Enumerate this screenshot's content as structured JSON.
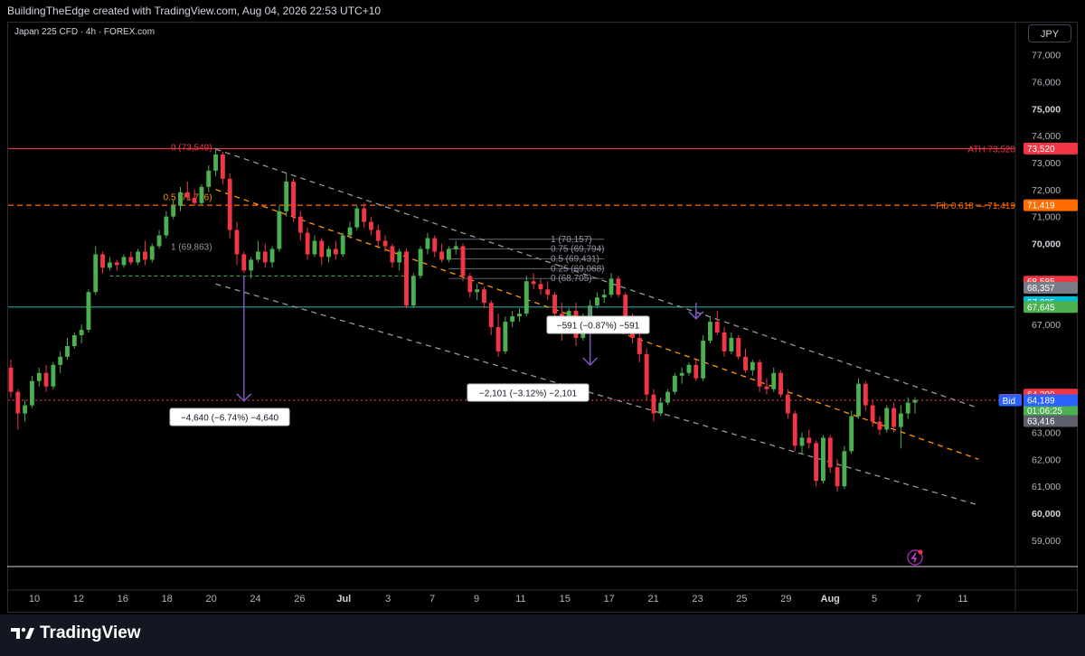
{
  "header": {
    "attribution": "BuildingTheEdge created with TradingView.com, Aug 04, 2026 22:53 UTC+10"
  },
  "toolbar": {
    "currency_label": "JPY"
  },
  "footer": {
    "brand": "TradingView"
  },
  "colors": {
    "up": "#4caf50",
    "down": "#f23645",
    "resistance": "#f23645",
    "fib": "#ff6d00",
    "support_green": "#4caf50",
    "teal": "#2a9d9d",
    "channel": "#9598a1",
    "channel_mid": "#ff9800",
    "measure": "#7e57c2"
  },
  "chart_data": {
    "type": "candlestick",
    "title": "Japan 225 CFD · 4h · FOREX.com",
    "y_axis": {
      "range": [
        58000,
        77500
      ],
      "ticks": [
        {
          "value": 77000,
          "label": "77,000"
        },
        {
          "value": 76000,
          "label": "76,000"
        },
        {
          "value": 75000,
          "label": "75,000",
          "major": true
        },
        {
          "value": 74000,
          "label": "74,000"
        },
        {
          "value": 73000,
          "label": "73,000"
        },
        {
          "value": 72000,
          "label": "72,000"
        },
        {
          "value": 71000,
          "label": "71,000"
        },
        {
          "value": 70000,
          "label": "70,000",
          "major": true
        },
        {
          "value": 67000,
          "label": "67,000"
        },
        {
          "value": 63000,
          "label": "63,000"
        },
        {
          "value": 62000,
          "label": "62,000"
        },
        {
          "value": 61000,
          "label": "61,000"
        },
        {
          "value": 60000,
          "label": "60,000",
          "major": true
        },
        {
          "value": 59000,
          "label": "59,000"
        }
      ]
    },
    "x_axis": {
      "ticks": [
        {
          "label": "10"
        },
        {
          "label": "12"
        },
        {
          "label": "16"
        },
        {
          "label": "18"
        },
        {
          "label": "20"
        },
        {
          "label": "24"
        },
        {
          "label": "26"
        },
        {
          "label": "Jul",
          "major": true
        },
        {
          "label": "3"
        },
        {
          "label": "7"
        },
        {
          "label": "9"
        },
        {
          "label": "11"
        },
        {
          "label": "15"
        },
        {
          "label": "17"
        },
        {
          "label": "21"
        },
        {
          "label": "23"
        },
        {
          "label": "25"
        },
        {
          "label": "29"
        },
        {
          "label": "Aug",
          "major": true
        },
        {
          "label": "5"
        },
        {
          "label": "7"
        },
        {
          "label": "11"
        }
      ]
    },
    "price_tags": [
      {
        "text": "73,520",
        "value": 73520,
        "color": "#f23645",
        "prefix": "ATH 73,520"
      },
      {
        "text": "71,419",
        "value": 71419,
        "color": "#ff6d00",
        "prefix": "Fib 0.618 — 71,419"
      },
      {
        "text": "68,585",
        "value": 68585,
        "color": "#f23645"
      },
      {
        "text": "68,357",
        "value": 68357,
        "color": "#787b86"
      },
      {
        "text": "67,825",
        "value": 67825,
        "color": "#00bcd4"
      },
      {
        "text": "67,645",
        "value": 67645,
        "color": "#4caf50"
      },
      {
        "text": "64,399",
        "value": 64399,
        "color": "#f23645"
      },
      {
        "text": "64,204",
        "value": 64204,
        "color": "#f23645",
        "prefix": "Ask"
      },
      {
        "text": "64,194",
        "value": 64194,
        "color": "#4caf50",
        "sub": "01:06:25"
      },
      {
        "text": "64,189",
        "value": 64189,
        "color": "#2962ff",
        "prefix": "Bid"
      },
      {
        "text": "63,416",
        "value": 63416,
        "color": "#5d606b"
      }
    ],
    "horizontal_lines": [
      {
        "value": 73520,
        "style": "solid",
        "color": "#f23645"
      },
      {
        "value": 71419,
        "style": "dashed",
        "color": "#ff6d00"
      },
      {
        "value": 67645,
        "style": "solid",
        "color": "#26a69a"
      },
      {
        "value": 64189,
        "style": "dotted",
        "color": "#f23645"
      }
    ],
    "fib_labels_left": [
      {
        "text": "0 (73,549)",
        "value": 73549
      },
      {
        "text": "0.5 (71,706)",
        "value": 71706
      },
      {
        "text": "1 (69,863)",
        "value": 69863
      }
    ],
    "fib_labels_mid": [
      {
        "text": "1 (70,157)",
        "value": 70157
      },
      {
        "text": "0.75 (69,794)",
        "value": 69794
      },
      {
        "text": "0.5 (69,431)",
        "value": 69431
      },
      {
        "text": "0.25 (69,068)",
        "value": 69068
      },
      {
        "text": "0 (68,705)",
        "value": 68705
      }
    ],
    "measurements": [
      {
        "text": "−4,640 (−6.74%) −4,640",
        "from": 68800,
        "to": 64160
      },
      {
        "text": "−2,101 (−3.12%) −2,101",
        "from": 67600,
        "to": 65499
      },
      {
        "text": "−591 (−0.87%) −591",
        "from": 67800,
        "to": 67209
      }
    ],
    "candles": [
      [
        65400,
        65700,
        64300,
        64500
      ],
      [
        64500,
        64600,
        63100,
        63700
      ],
      [
        63700,
        64200,
        63400,
        64000
      ],
      [
        64000,
        65100,
        63900,
        64900
      ],
      [
        64900,
        65400,
        64700,
        65200
      ],
      [
        65200,
        65500,
        64500,
        64700
      ],
      [
        64700,
        65600,
        64600,
        65500
      ],
      [
        65500,
        66000,
        65200,
        65800
      ],
      [
        65800,
        66500,
        65700,
        66200
      ],
      [
        66200,
        66700,
        66100,
        66600
      ],
      [
        66600,
        67000,
        66300,
        66800
      ],
      [
        66800,
        68300,
        66700,
        68200
      ],
      [
        68200,
        69900,
        68100,
        69600
      ],
      [
        69600,
        69700,
        68900,
        69100
      ],
      [
        69100,
        69500,
        69000,
        69300
      ],
      [
        69300,
        69400,
        69000,
        69200
      ],
      [
        69200,
        69600,
        69100,
        69500
      ],
      [
        69500,
        69700,
        69200,
        69300
      ],
      [
        69300,
        69800,
        69200,
        69700
      ],
      [
        69700,
        70100,
        69200,
        69400
      ],
      [
        69400,
        70000,
        69300,
        69900
      ],
      [
        69900,
        70500,
        69800,
        70300
      ],
      [
        70300,
        71200,
        70200,
        71000
      ],
      [
        71000,
        71600,
        70900,
        71400
      ],
      [
        71400,
        72100,
        71200,
        71900
      ],
      [
        71900,
        72300,
        71600,
        71700
      ],
      [
        71700,
        72000,
        71400,
        71500
      ],
      [
        71500,
        72200,
        71400,
        72100
      ],
      [
        72100,
        72900,
        71900,
        72700
      ],
      [
        72700,
        73550,
        72500,
        73300
      ],
      [
        73300,
        73400,
        72200,
        72400
      ],
      [
        72400,
        72600,
        70200,
        70500
      ],
      [
        70500,
        70800,
        69200,
        69600
      ],
      [
        69600,
        69700,
        68900,
        69000
      ],
      [
        69000,
        69500,
        68700,
        69400
      ],
      [
        69400,
        70100,
        69300,
        69700
      ],
      [
        69700,
        70000,
        69100,
        69300
      ],
      [
        69300,
        69900,
        69100,
        69800
      ],
      [
        69800,
        71400,
        69700,
        71200
      ],
      [
        71200,
        72600,
        71000,
        72300
      ],
      [
        72300,
        72400,
        70800,
        71000
      ],
      [
        71000,
        71200,
        70100,
        70400
      ],
      [
        70400,
        70600,
        69400,
        69600
      ],
      [
        69600,
        70300,
        69500,
        70100
      ],
      [
        70100,
        70200,
        69200,
        69500
      ],
      [
        69500,
        69900,
        69300,
        69800
      ],
      [
        69800,
        70100,
        69400,
        69600
      ],
      [
        69600,
        70400,
        69500,
        70300
      ],
      [
        70300,
        70800,
        70200,
        70600
      ],
      [
        70600,
        71400,
        70500,
        71300
      ],
      [
        71300,
        71500,
        70600,
        70800
      ],
      [
        70800,
        71000,
        70300,
        70500
      ],
      [
        70500,
        70700,
        69900,
        70100
      ],
      [
        70100,
        70300,
        69700,
        69900
      ],
      [
        69900,
        70000,
        69100,
        69300
      ],
      [
        69300,
        69800,
        69000,
        69700
      ],
      [
        69700,
        69800,
        67600,
        67700
      ],
      [
        67700,
        68900,
        67600,
        68800
      ],
      [
        68800,
        69900,
        68700,
        69800
      ],
      [
        69800,
        70400,
        69600,
        70200
      ],
      [
        70200,
        70300,
        69500,
        69700
      ],
      [
        69700,
        70000,
        69300,
        69400
      ],
      [
        69400,
        69900,
        69300,
        69800
      ],
      [
        69800,
        70100,
        69600,
        69900
      ],
      [
        69900,
        70000,
        68600,
        68800
      ],
      [
        68800,
        68900,
        68000,
        68200
      ],
      [
        68200,
        68500,
        67900,
        68300
      ],
      [
        68300,
        68400,
        67600,
        67800
      ],
      [
        67800,
        67900,
        66600,
        66900
      ],
      [
        66900,
        67400,
        65800,
        66000
      ],
      [
        66000,
        67300,
        65900,
        67100
      ],
      [
        67100,
        67500,
        66900,
        67300
      ],
      [
        67300,
        67600,
        67100,
        67400
      ],
      [
        67400,
        68800,
        67300,
        68600
      ],
      [
        68600,
        68900,
        68300,
        68500
      ],
      [
        68500,
        68700,
        68100,
        68300
      ],
      [
        68300,
        68600,
        67900,
        68100
      ],
      [
        68100,
        68200,
        67200,
        67400
      ],
      [
        67400,
        67800,
        66400,
        66900
      ],
      [
        66900,
        67600,
        66700,
        67500
      ],
      [
        67500,
        67800,
        66200,
        66500
      ],
      [
        66500,
        67400,
        66400,
        67200
      ],
      [
        67200,
        67900,
        67100,
        67700
      ],
      [
        67700,
        68200,
        67600,
        68000
      ],
      [
        68000,
        68300,
        67800,
        68100
      ],
      [
        68100,
        68900,
        68000,
        68700
      ],
      [
        68700,
        68800,
        68000,
        68100
      ],
      [
        68100,
        68200,
        67000,
        67200
      ],
      [
        67200,
        67400,
        66300,
        66500
      ],
      [
        66500,
        66700,
        65600,
        65900
      ],
      [
        65900,
        66100,
        64200,
        64400
      ],
      [
        64400,
        64600,
        63400,
        63700
      ],
      [
        63700,
        64300,
        63600,
        64100
      ],
      [
        64100,
        64600,
        64000,
        64500
      ],
      [
        64500,
        65200,
        64400,
        65100
      ],
      [
        65100,
        65400,
        64800,
        65200
      ],
      [
        65200,
        65600,
        65100,
        65500
      ],
      [
        65500,
        65700,
        64900,
        65000
      ],
      [
        65000,
        66600,
        64900,
        66400
      ],
      [
        66400,
        67300,
        66300,
        67100
      ],
      [
        67100,
        67500,
        66600,
        66700
      ],
      [
        66700,
        66900,
        65800,
        66000
      ],
      [
        66000,
        66700,
        65900,
        66500
      ],
      [
        66500,
        66600,
        65700,
        65800
      ],
      [
        65800,
        66100,
        65200,
        65300
      ],
      [
        65300,
        65700,
        65100,
        65600
      ],
      [
        65600,
        65700,
        64500,
        64700
      ],
      [
        64700,
        65000,
        64400,
        64600
      ],
      [
        64600,
        65400,
        64500,
        65200
      ],
      [
        65200,
        65300,
        64300,
        64400
      ],
      [
        64400,
        64600,
        63500,
        63700
      ],
      [
        63700,
        63800,
        62300,
        62500
      ],
      [
        62500,
        63000,
        62200,
        62800
      ],
      [
        62800,
        63100,
        62400,
        62600
      ],
      [
        62600,
        62700,
        61000,
        61200
      ],
      [
        61200,
        62900,
        61100,
        62800
      ],
      [
        62800,
        62900,
        61500,
        61700
      ],
      [
        61700,
        62000,
        60800,
        61000
      ],
      [
        61000,
        62500,
        60900,
        62300
      ],
      [
        62300,
        63800,
        62200,
        63600
      ],
      [
        63600,
        65000,
        63500,
        64800
      ],
      [
        64800,
        64900,
        63800,
        64000
      ],
      [
        64000,
        64200,
        63200,
        63400
      ],
      [
        63400,
        63600,
        62900,
        63100
      ],
      [
        63100,
        64000,
        63000,
        63900
      ],
      [
        63900,
        64100,
        63000,
        63200
      ],
      [
        63200,
        64000,
        62400,
        63700
      ],
      [
        63700,
        64300,
        63500,
        64100
      ],
      [
        64100,
        64300,
        63700,
        64194
      ]
    ]
  }
}
